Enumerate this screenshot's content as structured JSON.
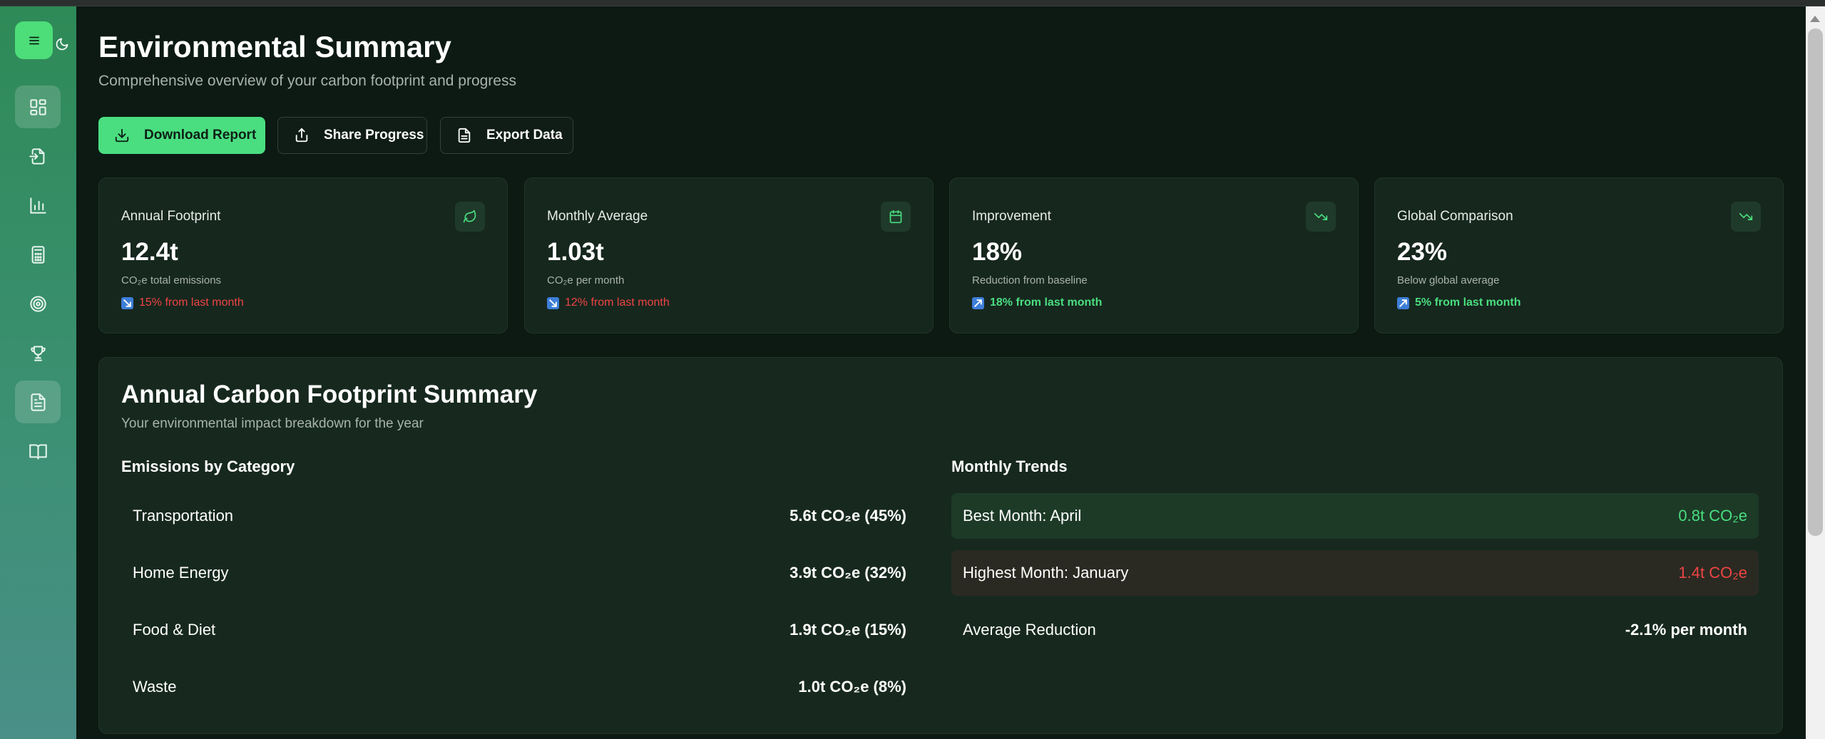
{
  "page": {
    "title": "Environmental Summary",
    "subtitle": "Comprehensive overview of your carbon footprint and progress"
  },
  "sidebar": {
    "items": [
      {
        "icon": "dashboard-icon",
        "active": true
      },
      {
        "icon": "log-in-icon",
        "active": false
      },
      {
        "icon": "bar-chart-icon",
        "active": false
      },
      {
        "icon": "calculator-icon",
        "active": false
      },
      {
        "icon": "target-icon",
        "active": false
      },
      {
        "icon": "trophy-icon",
        "active": false
      },
      {
        "icon": "report-icon",
        "active": true
      },
      {
        "icon": "book-icon",
        "active": false
      }
    ]
  },
  "actions": {
    "download": "Download Report",
    "share": "Share Progress",
    "export": "Export Data"
  },
  "stats": [
    {
      "label": "Annual Footprint",
      "value": "12.4t",
      "desc": "CO₂e total emissions",
      "change": "15% from last month",
      "trend": "negative",
      "icon": "leaf-icon"
    },
    {
      "label": "Monthly Average",
      "value": "1.03t",
      "desc": "CO₂e per month",
      "change": "12% from last month",
      "trend": "negative",
      "icon": "calendar-icon"
    },
    {
      "label": "Improvement",
      "value": "18%",
      "desc": "Reduction from baseline",
      "change": "18% from last month",
      "trend": "positive",
      "icon": "trending-down-icon"
    },
    {
      "label": "Global Comparison",
      "value": "23%",
      "desc": "Below global average",
      "change": "5% from last month",
      "trend": "positive",
      "icon": "trending-down-icon"
    }
  ],
  "summary": {
    "title": "Annual Carbon Footprint Summary",
    "subtitle": "Your environmental impact breakdown for the year",
    "categories_heading": "Emissions by Category",
    "categories": [
      {
        "label": "Transportation",
        "value": "5.6t CO₂e (45%)"
      },
      {
        "label": "Home Energy",
        "value": "3.9t CO₂e (32%)"
      },
      {
        "label": "Food & Diet",
        "value": "1.9t CO₂e (15%)"
      },
      {
        "label": "Waste",
        "value": "1.0t CO₂e (8%)"
      }
    ],
    "trends_heading": "Monthly Trends",
    "trends": [
      {
        "label": "Best Month: April",
        "value": "0.8t CO₂e"
      },
      {
        "label": "Highest Month: January",
        "value": "1.4t CO₂e"
      },
      {
        "label": "Average Reduction",
        "value": "-2.1% per month"
      }
    ]
  },
  "colors": {
    "accent": "#4ade80",
    "negative": "#ef4444",
    "background": "#0c1a13",
    "card": "#16271e"
  }
}
